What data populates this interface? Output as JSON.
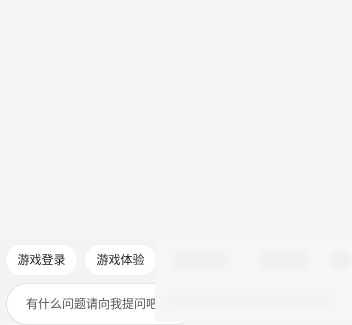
{
  "suggestions": [
    {
      "label": "游戏登录"
    },
    {
      "label": "游戏体验"
    }
  ],
  "chat_input": {
    "placeholder": "有什么问题请向我提问吧"
  }
}
